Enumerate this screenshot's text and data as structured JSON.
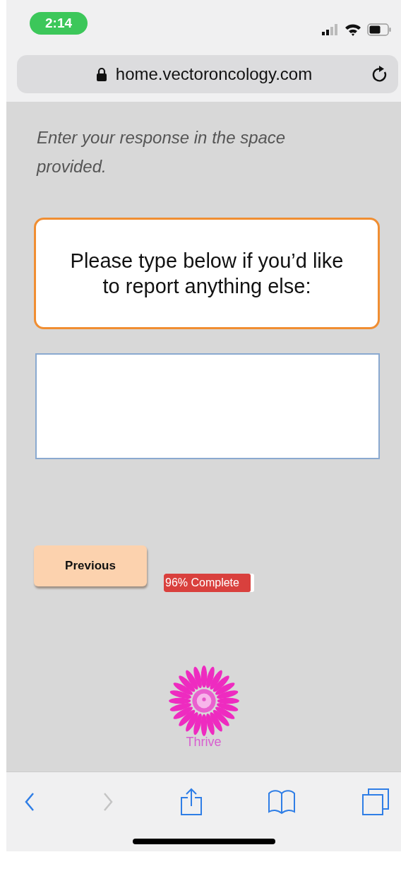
{
  "status_bar": {
    "time": "2:14"
  },
  "address_bar": {
    "url": "home.vectoroncology.com"
  },
  "instruction": "Enter your response in the space provided.",
  "question": "Please type below if you’d like to report anything else:",
  "previous_button": {
    "label": "Previous"
  },
  "progress": {
    "label": "96% Complete",
    "level": 0.96
  },
  "logo": {
    "label": "Thrive"
  },
  "toolbar": [
    {
      "kind": "back",
      "disabled": false
    },
    {
      "kind": "forward",
      "disabled": true
    },
    {
      "kind": "share",
      "disabled": false
    },
    {
      "kind": "bookmarks",
      "disabled": false
    },
    {
      "kind": "tabs",
      "disabled": false
    }
  ]
}
